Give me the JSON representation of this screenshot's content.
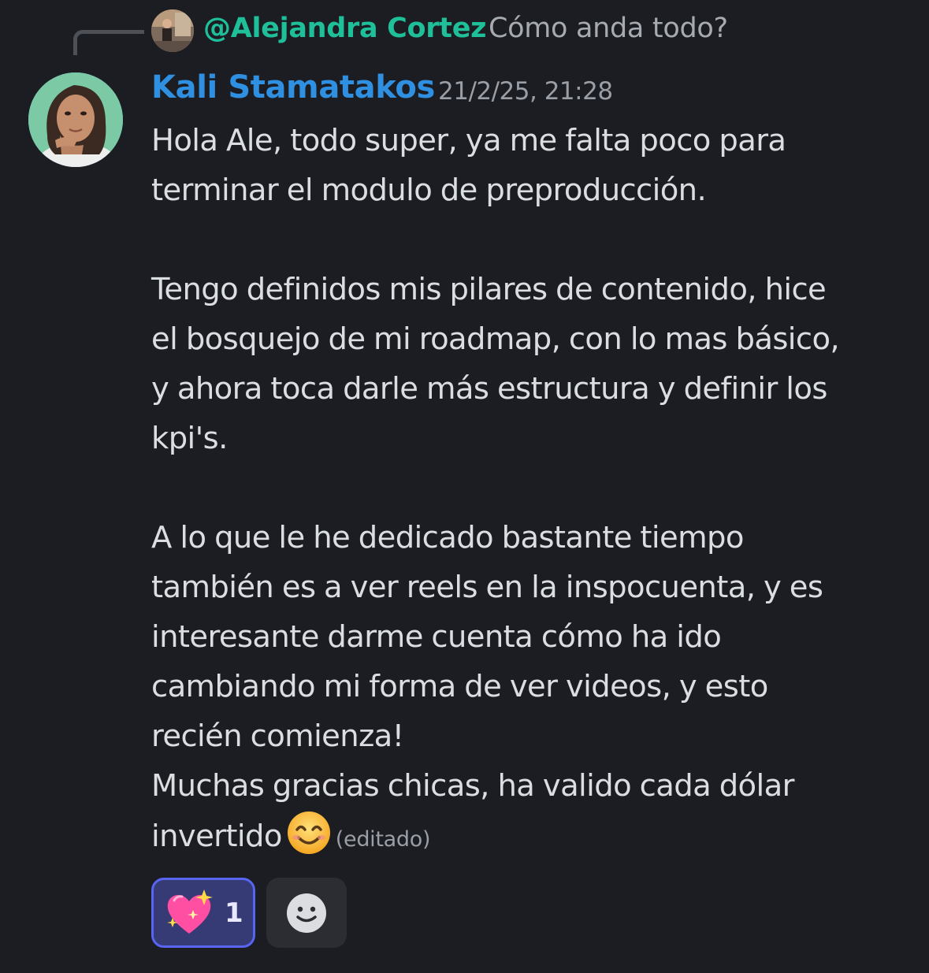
{
  "reply": {
    "author": "@Alejandra Cortez",
    "text": "Cómo anda todo?"
  },
  "message": {
    "author": "Kali Stamatakos",
    "timestamp": "21/2/25, 21:28",
    "lines": {
      "l1": "Hola Ale, todo super, ya me falta poco para",
      "l2": "terminar el modulo de preproducción.",
      "l3": "Tengo definidos mis pilares de contenido, hice",
      "l4": "el bosquejo de mi roadmap, con lo mas básico,",
      "l5": "y ahora toca darle más estructura y definir los",
      "l6": "kpi's.",
      "l7": "A lo que le he dedicado bastante tiempo",
      "l8": "también es a ver reels en la inspocuenta, y es",
      "l9": "interesante darme cuenta cómo ha ido",
      "l10": "cambiando mi forma de ver videos, y esto",
      "l11": "recién comienza!",
      "l12": "Muchas gracias chicas, ha valido cada dólar",
      "l13": "invertido"
    },
    "edited_label": "(editado)"
  },
  "reactions": [
    {
      "emoji": "sparkling-heart",
      "count": "1",
      "active": true
    }
  ],
  "icons": {
    "smile": "smiling-face-with-smiling-eyes",
    "add_reaction": "add-reaction-smiley"
  },
  "colors": {
    "background": "#1c1d22",
    "reply_author": "#1fbf9a",
    "author": "#2f8fe0",
    "reaction_bg": "#363a75",
    "reaction_border": "#5865f2"
  }
}
